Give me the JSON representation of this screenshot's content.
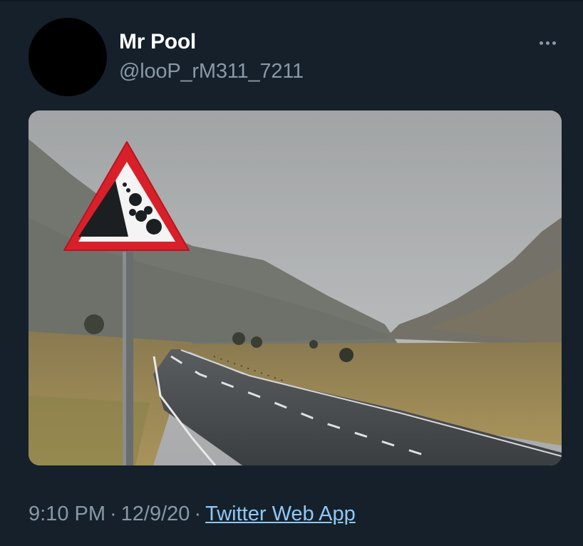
{
  "tweet": {
    "author": {
      "display_name": "Mr Pool",
      "handle": "@looP_rM311_7211"
    },
    "media": {
      "icon": "falling-rocks-warning-sign"
    },
    "timestamp": {
      "time": "9:10 PM",
      "separator": "·",
      "date": "12/9/20",
      "source": "Twitter Web App"
    },
    "more_icon": "more-horizontal-icon"
  },
  "colors": {
    "background": "#15202b",
    "name": "#ffffff",
    "secondary": "#8899a6",
    "link": "#8ec9f5"
  }
}
